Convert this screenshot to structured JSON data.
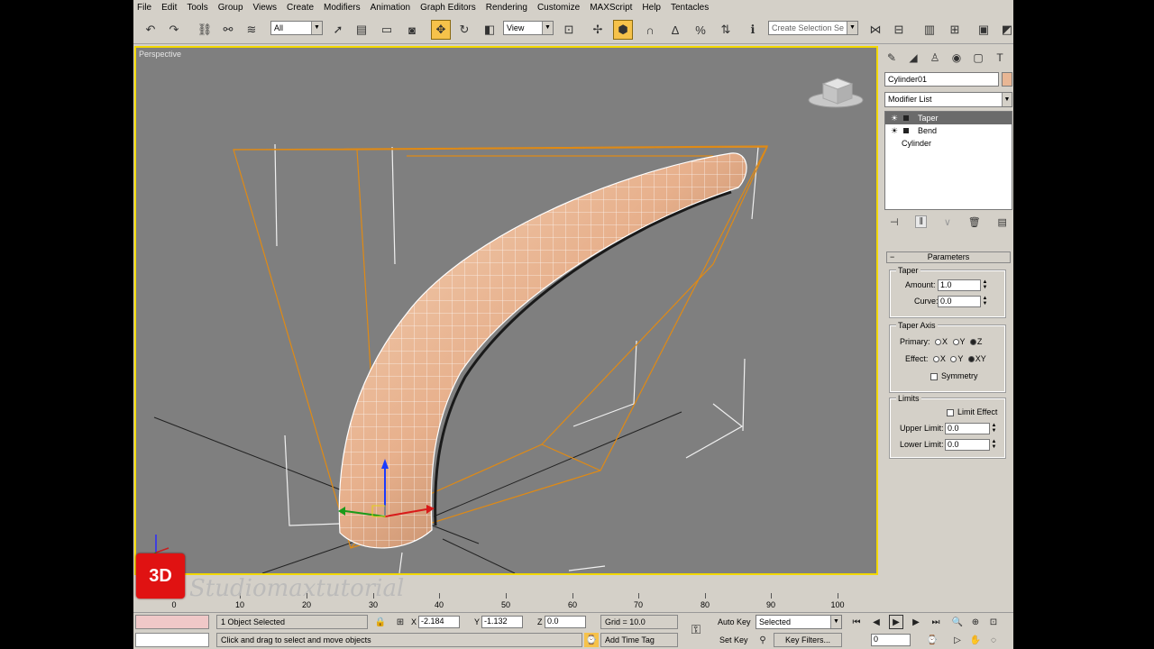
{
  "menu": [
    "File",
    "Edit",
    "Tools",
    "Group",
    "Views",
    "Create",
    "Modifiers",
    "Animation",
    "Graph Editors",
    "Rendering",
    "Customize",
    "MAXScript",
    "Help",
    "Tentacles"
  ],
  "toolbar": {
    "selection_filter": "All",
    "ref_coord": "View",
    "named_selection": "Create Selection Se"
  },
  "viewport": {
    "label": "Perspective"
  },
  "command_panel": {
    "object_name": "Cylinder01",
    "modifier_list": "Modifier List",
    "stack": [
      {
        "label": "Taper",
        "selected": true
      },
      {
        "label": "Bend",
        "selected": false
      },
      {
        "label": "Cylinder",
        "selected": false
      }
    ],
    "rollout_title": "Parameters",
    "taper_group": "Taper",
    "amount_label": "Amount:",
    "amount_value": "1.0",
    "curve_label": "Curve:",
    "curve_value": "0.0",
    "taper_axis_group": "Taper Axis",
    "primary_label": "Primary:",
    "primary_options": [
      "X",
      "Y",
      "Z"
    ],
    "effect_label": "Effect:",
    "effect_options": [
      "X",
      "Y",
      "XY"
    ],
    "symmetry_label": "Symmetry",
    "limits_group": "Limits",
    "limit_effect_label": "Limit Effect",
    "upper_limit_label": "Upper Limit:",
    "upper_limit_value": "0.0",
    "lower_limit_label": "Lower Limit:",
    "lower_limit_value": "0.0"
  },
  "timeline": {
    "ticks": [
      "0",
      "10",
      "20",
      "30",
      "40",
      "50",
      "60",
      "70",
      "80",
      "90",
      "100"
    ]
  },
  "status": {
    "selection_info": "1 Object Selected",
    "prompt": "Click and drag to select and move objects",
    "x_label": "X",
    "x_value": "-2.184",
    "y_label": "Y",
    "y_value": "-1.132",
    "z_label": "Z",
    "z_value": "0.0",
    "grid": "Grid = 10.0",
    "add_time_tag": "Add Time Tag",
    "auto_key": "Auto Key",
    "auto_key_dropdown": "Selected",
    "set_key": "Set Key",
    "key_filters": "Key Filters...",
    "frame": "0"
  },
  "watermark": {
    "badge": "3D",
    "text": "Studiomaxtutorial"
  },
  "colors": {
    "ui_gray": "#d4d0c8",
    "viewport_bg": "#7f7f7f",
    "active_border": "#f2d800",
    "object_color": "#e8b694",
    "gizmo_orange": "#e08a14"
  }
}
